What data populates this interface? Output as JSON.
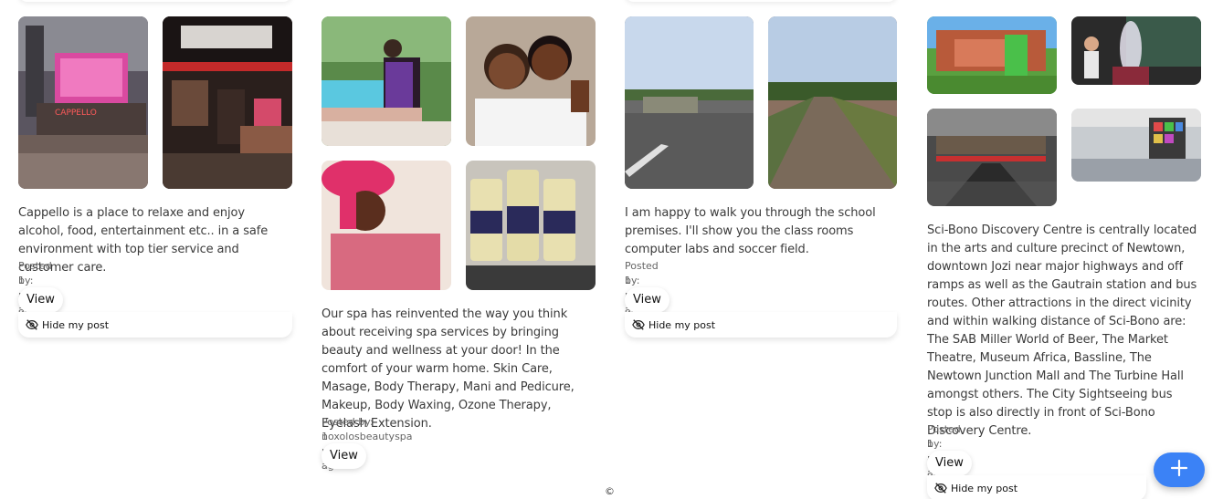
{
  "posts": [
    {
      "description": "Cappello is a place to relaxe and enjoy alcohol, food, entertainment etc.. in a safe environment with top tier service and customer care.",
      "posted_by": "Posted by: alec",
      "time_ago": "1 month ago",
      "view_label": "View",
      "hide_label": "Hide my post",
      "images": [
        "restaurant-exterior-night",
        "restaurant-interior"
      ]
    },
    {
      "description": "Our spa has reinvented the way you think about receiving spa services by bringing beauty and wellness at your door! In the comfort of your warm home. Skin Care, Masage, Body Therapy, Mani and Pedicure, Makeup, Body Waxing, Ozone Therapy, Eyelash Extension.",
      "posted_by": "Posted by: noxolosbeautyspa",
      "time_ago": "1 month ago",
      "view_label": "View",
      "images": [
        "massage-poolside",
        "couple-in-robes",
        "woman-towel-head",
        "product-jars"
      ]
    },
    {
      "description": "I am happy to walk you through the school premises. I'll show you the class rooms computer labs and soccer field.",
      "posted_by": "Posted by: alec",
      "time_ago": "1 month ago",
      "view_label": "View",
      "hide_label": "Hide my post",
      "images": [
        "school-gate-road",
        "school-path"
      ]
    },
    {
      "description": "Sci-Bono Discovery Centre is centrally located in the arts and culture precinct of Newtown, downtown Jozi near major highways and off ramps as well as the Gautrain station and bus routes. Other attractions in the direct vicinity and within walking distance of Sci-Bono are: The SAB Miller World of Beer, The Market Theatre, Museum Africa, Bassline, The Newtown Junction Mall and The Turbine Hall amongst others. The City Sightseeing bus stop is also directly in front of Sci-Bono Discovery Centre.",
      "posted_by": "Posted by: alec",
      "time_ago": "1 month ago",
      "view_label": "View",
      "hide_label": "Hide my post",
      "images": [
        "science-centre-exterior",
        "science-show-stage",
        "centre-interior-escalators",
        "exhibit-hall"
      ]
    }
  ],
  "footer": {
    "copyright": "©"
  },
  "fab": {
    "icon": "plus-icon",
    "color": "#3b82f6"
  }
}
